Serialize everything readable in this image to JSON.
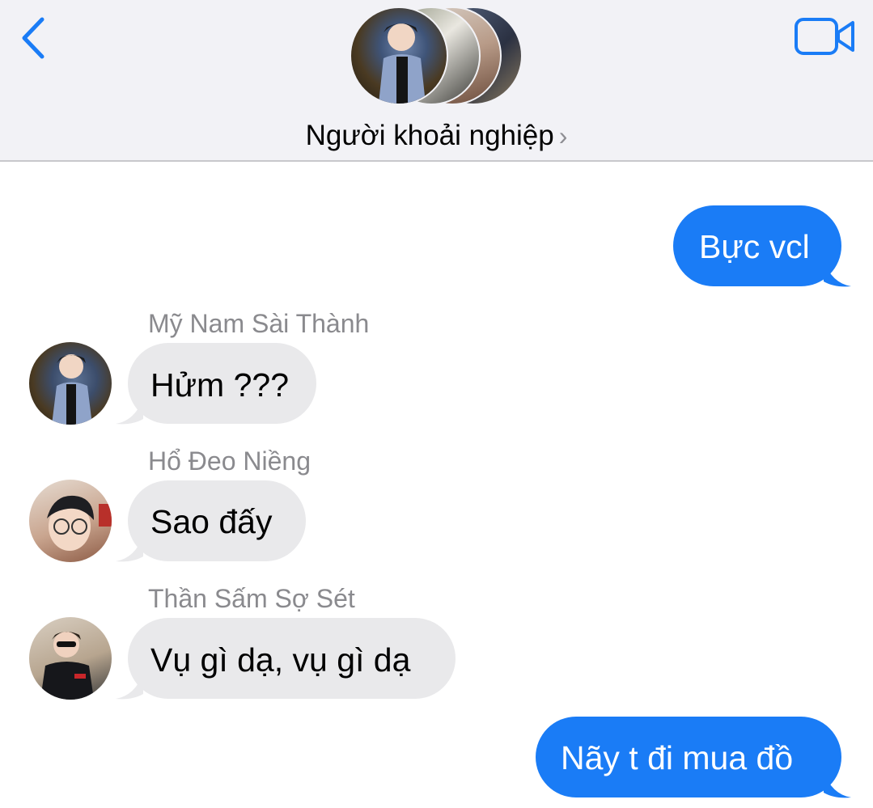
{
  "header": {
    "group_name": "Người khoải nghiệp",
    "chevron": "›",
    "back_icon": "chevron-left-icon",
    "video_icon": "video-camera-icon",
    "accent_color": "#1a7cf6"
  },
  "messages": [
    {
      "direction": "outgoing",
      "text": "Bực vcl"
    },
    {
      "direction": "incoming",
      "sender": "Mỹ Nam Sài Thành",
      "text": "Hửm ???"
    },
    {
      "direction": "incoming",
      "sender": "Hổ Đeo Niềng",
      "text": "Sao đấy"
    },
    {
      "direction": "incoming",
      "sender": "Thần Sấm Sợ Sét",
      "text": "Vụ gì dạ, vụ gì dạ"
    },
    {
      "direction": "outgoing",
      "text": "Nãy t đi mua đồ"
    }
  ],
  "colors": {
    "outgoing_bubble": "#1a7cf6",
    "incoming_bubble": "#e9e9eb",
    "header_bg": "#f2f2f6",
    "sender_name": "#8a8a8e"
  }
}
